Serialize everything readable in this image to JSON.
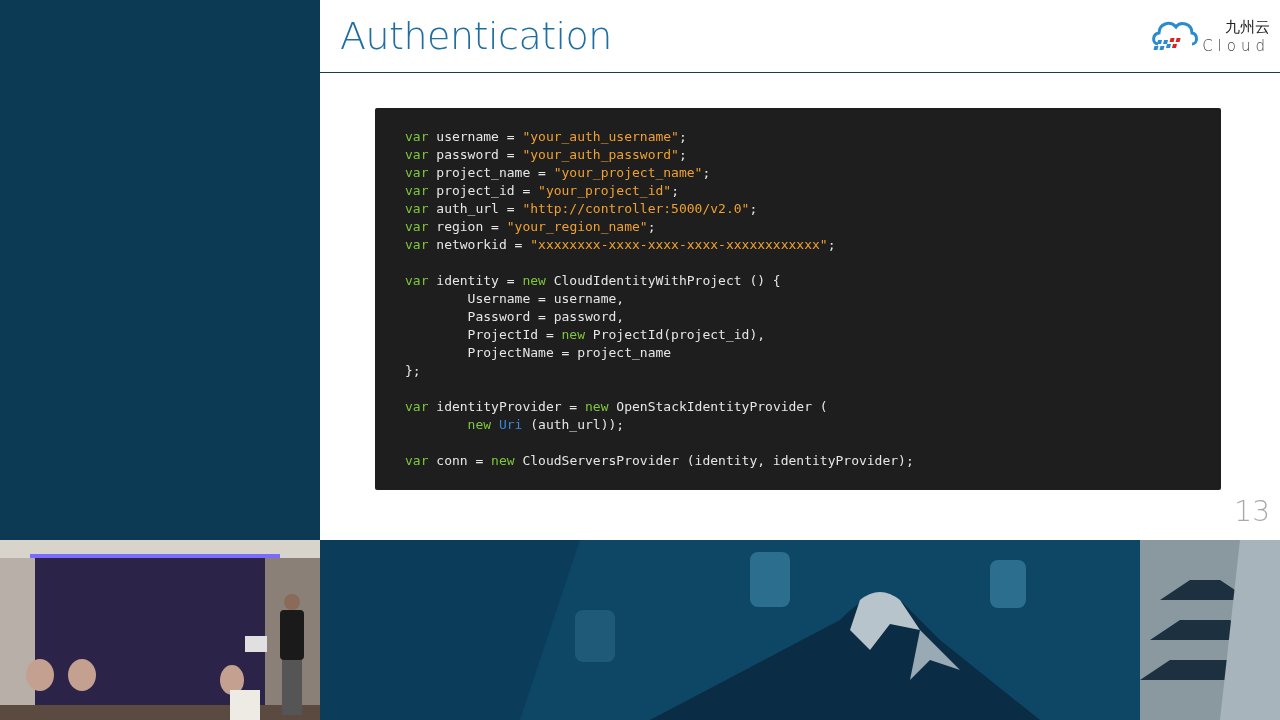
{
  "slide": {
    "title": "Authentication",
    "logo": {
      "chinese": "九州云",
      "latin": "Cloud"
    },
    "page_number": "13",
    "code_blocks": [
      {
        "lines": [
          [
            {
              "kind": "keyword",
              "text": "var"
            },
            {
              "kind": "plain",
              "text": " username = "
            },
            {
              "kind": "string",
              "text": "\"your_auth_username\""
            },
            {
              "kind": "plain",
              "text": ";"
            }
          ],
          [
            {
              "kind": "keyword",
              "text": "var"
            },
            {
              "kind": "plain",
              "text": " password = "
            },
            {
              "kind": "string",
              "text": "\"your_auth_password\""
            },
            {
              "kind": "plain",
              "text": ";"
            }
          ],
          [
            {
              "kind": "keyword",
              "text": "var"
            },
            {
              "kind": "plain",
              "text": " project_name = "
            },
            {
              "kind": "string",
              "text": "\"your_project_name\""
            },
            {
              "kind": "plain",
              "text": ";"
            }
          ],
          [
            {
              "kind": "keyword",
              "text": "var"
            },
            {
              "kind": "plain",
              "text": " project_id = "
            },
            {
              "kind": "string",
              "text": "\"your_project_id\""
            },
            {
              "kind": "plain",
              "text": ";"
            }
          ],
          [
            {
              "kind": "keyword",
              "text": "var"
            },
            {
              "kind": "plain",
              "text": " auth_url = "
            },
            {
              "kind": "string",
              "text": "\"http://controller:5000/v2.0\""
            },
            {
              "kind": "plain",
              "text": ";"
            }
          ],
          [
            {
              "kind": "keyword",
              "text": "var"
            },
            {
              "kind": "plain",
              "text": " region = "
            },
            {
              "kind": "string",
              "text": "\"your_region_name\""
            },
            {
              "kind": "plain",
              "text": ";"
            }
          ],
          [
            {
              "kind": "keyword",
              "text": "var"
            },
            {
              "kind": "plain",
              "text": " networkid = "
            },
            {
              "kind": "string",
              "text": "\"xxxxxxxx-xxxx-xxxx-xxxx-xxxxxxxxxxxx\""
            },
            {
              "kind": "plain",
              "text": ";"
            }
          ]
        ]
      },
      {
        "lines": [
          [
            {
              "kind": "keyword",
              "text": "var"
            },
            {
              "kind": "plain",
              "text": " identity = "
            },
            {
              "kind": "keyword",
              "text": "new"
            },
            {
              "kind": "plain",
              "text": " CloudIdentityWithProject () {"
            }
          ],
          [
            {
              "kind": "plain",
              "text": "        Username = username,"
            }
          ],
          [
            {
              "kind": "plain",
              "text": "        Password = password,"
            }
          ],
          [
            {
              "kind": "plain",
              "text": "        ProjectId = "
            },
            {
              "kind": "keyword",
              "text": "new"
            },
            {
              "kind": "plain",
              "text": " ProjectId(project_id),"
            }
          ],
          [
            {
              "kind": "plain",
              "text": "        ProjectName = project_name"
            }
          ],
          [
            {
              "kind": "plain",
              "text": "};"
            }
          ]
        ]
      },
      {
        "lines": [
          [
            {
              "kind": "keyword",
              "text": "var"
            },
            {
              "kind": "plain",
              "text": " identityProvider = "
            },
            {
              "kind": "keyword",
              "text": "new"
            },
            {
              "kind": "plain",
              "text": " OpenStackIdentityProvider ("
            }
          ],
          [
            {
              "kind": "keyword",
              "text": "        new"
            },
            {
              "kind": "type",
              "text": " Uri"
            },
            {
              "kind": "plain",
              "text": " (auth_url));"
            }
          ]
        ]
      },
      {
        "lines": [
          [
            {
              "kind": "keyword",
              "text": "var"
            },
            {
              "kind": "plain",
              "text": " conn = "
            },
            {
              "kind": "keyword",
              "text": "new"
            },
            {
              "kind": "plain",
              "text": " CloudServersProvider (identity, identityProvider);"
            }
          ]
        ]
      }
    ]
  }
}
